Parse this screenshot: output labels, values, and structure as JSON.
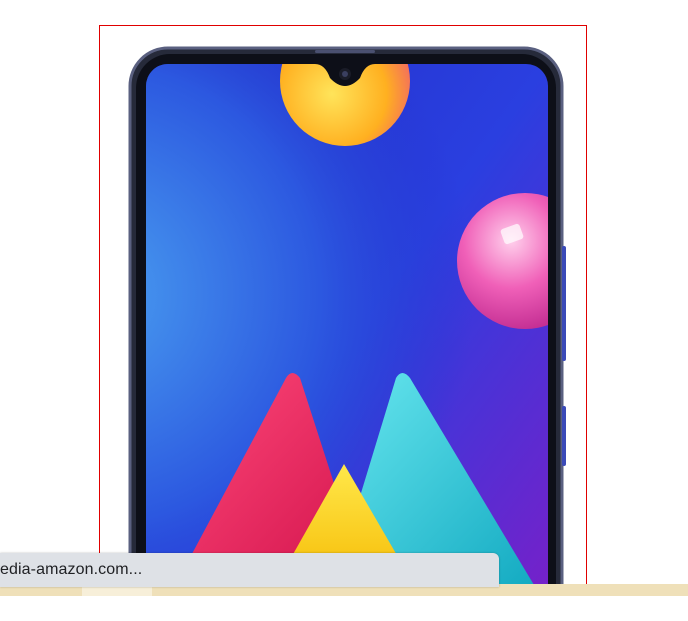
{
  "status_bar": {
    "url_text": "edia-amazon.com..."
  },
  "product_image": {
    "subject": "smartphone front view with colorful wallpaper",
    "selection_outline_color": "#e00000",
    "icons": [
      "phone-icon",
      "camera-notch-icon"
    ]
  },
  "colors": {
    "phone_frame": "#2a2d3e",
    "screen_blue": "#1e2fd0",
    "bottom_strip": "#efe0b9",
    "status_bar_bg": "#dee1e6"
  }
}
